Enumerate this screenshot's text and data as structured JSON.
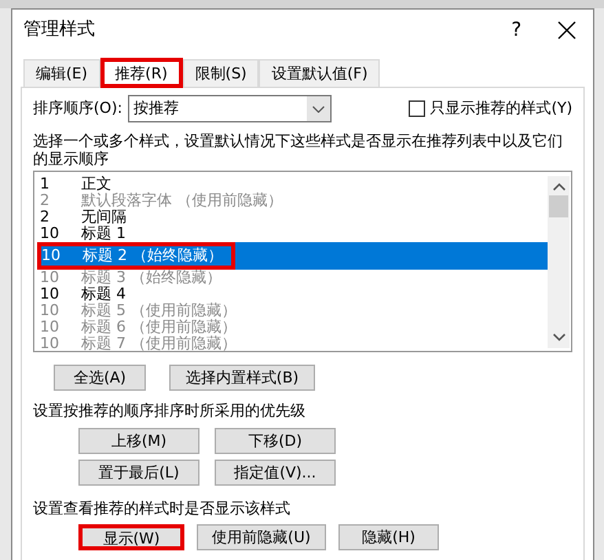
{
  "window": {
    "title": "管理样式",
    "help": "?"
  },
  "tabs": [
    {
      "label": "编辑(E)",
      "selected": false,
      "callout": false
    },
    {
      "label": "推荐(R)",
      "selected": true,
      "callout": true
    },
    {
      "label": "限制(S)",
      "selected": false,
      "callout": false
    },
    {
      "label": "设置默认值(F)",
      "selected": false,
      "callout": false
    }
  ],
  "sort": {
    "label": "排序顺序(O):",
    "value": "按推荐"
  },
  "only_recommended": {
    "label": "只显示推荐的样式(Y)",
    "checked": false
  },
  "description": "选择一个或多个样式，设置默认情况下这些样式是否显示在推荐列表中以及它们的显示顺序",
  "styles": [
    {
      "priority": "1",
      "name": "正文",
      "hidden": false,
      "selected": false,
      "callout": false
    },
    {
      "priority": "2",
      "name": "默认段落字体 （使用前隐藏）",
      "hidden": true,
      "selected": false,
      "callout": false
    },
    {
      "priority": "2",
      "name": "无间隔",
      "hidden": false,
      "selected": false,
      "callout": false
    },
    {
      "priority": "10",
      "name": "标题 1",
      "hidden": false,
      "selected": false,
      "callout": false
    },
    {
      "priority": "10",
      "name": "标题 2 （始终隐藏）",
      "hidden": true,
      "selected": true,
      "callout": true
    },
    {
      "priority": "10",
      "name": "标题 3 （始终隐藏）",
      "hidden": true,
      "selected": false,
      "callout": false
    },
    {
      "priority": "10",
      "name": "标题 4",
      "hidden": false,
      "selected": false,
      "callout": false
    },
    {
      "priority": "10",
      "name": "标题 5 （使用前隐藏）",
      "hidden": true,
      "selected": false,
      "callout": false
    },
    {
      "priority": "10",
      "name": "标题 6 （使用前隐藏）",
      "hidden": true,
      "selected": false,
      "callout": false
    },
    {
      "priority": "10",
      "name": "标题 7 （使用前隐藏）",
      "hidden": true,
      "selected": false,
      "callout": false
    }
  ],
  "select_buttons": [
    "全选(A)",
    "选择内置样式(B)"
  ],
  "priority_section": {
    "label": "设置按推荐的顺序排序时所采用的优先级",
    "buttons": [
      "上移(M)",
      "下移(D)",
      "置于最后(L)",
      "指定值(V)..."
    ]
  },
  "visibility_section": {
    "label": "设置查看推荐的样式时是否显示该样式",
    "buttons": [
      {
        "label": "显示(W)",
        "callout": true
      },
      {
        "label": "使用前隐藏(U)",
        "callout": false
      },
      {
        "label": "隐藏(H)",
        "callout": false
      }
    ]
  }
}
